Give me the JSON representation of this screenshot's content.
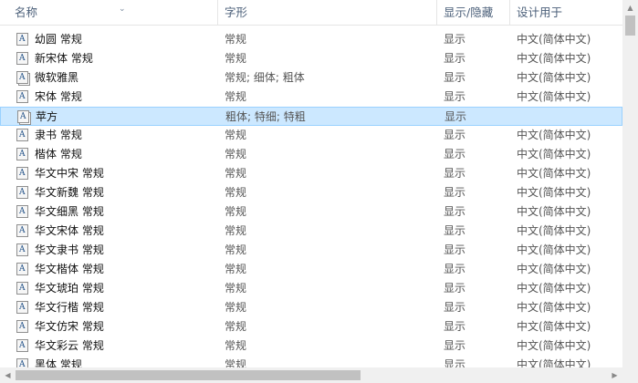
{
  "columns": {
    "name": "名称",
    "style": "字形",
    "show_hide": "显示/隐藏",
    "designed_for": "设计用于"
  },
  "icons": {
    "font_file": "font-file-icon",
    "sort": "chevron-down-icon"
  },
  "colors": {
    "selection_bg": "#cce8ff",
    "selection_border": "#99d1ff",
    "header_text": "#4c607a"
  },
  "rows": [
    {
      "name": "幼圆 常规",
      "style": "常规",
      "show": "显示",
      "design": "中文(简体中文)",
      "family": false,
      "selected": false
    },
    {
      "name": "新宋体 常规",
      "style": "常规",
      "show": "显示",
      "design": "中文(简体中文)",
      "family": false,
      "selected": false
    },
    {
      "name": "微软雅黑",
      "style": "常规; 细体; 粗体",
      "show": "显示",
      "design": "中文(简体中文)",
      "family": true,
      "selected": false
    },
    {
      "name": "宋体 常规",
      "style": "常规",
      "show": "显示",
      "design": "中文(简体中文)",
      "family": false,
      "selected": false
    },
    {
      "name": "苹方",
      "style": "粗体; 特细; 特粗",
      "show": "显示",
      "design": "",
      "family": true,
      "selected": true
    },
    {
      "name": "隶书 常规",
      "style": "常规",
      "show": "显示",
      "design": "中文(简体中文)",
      "family": false,
      "selected": false
    },
    {
      "name": "楷体 常规",
      "style": "常规",
      "show": "显示",
      "design": "中文(简体中文)",
      "family": false,
      "selected": false
    },
    {
      "name": "华文中宋 常规",
      "style": "常规",
      "show": "显示",
      "design": "中文(简体中文)",
      "family": false,
      "selected": false
    },
    {
      "name": "华文新魏 常规",
      "style": "常规",
      "show": "显示",
      "design": "中文(简体中文)",
      "family": false,
      "selected": false
    },
    {
      "name": "华文细黑 常规",
      "style": "常规",
      "show": "显示",
      "design": "中文(简体中文)",
      "family": false,
      "selected": false
    },
    {
      "name": "华文宋体 常规",
      "style": "常规",
      "show": "显示",
      "design": "中文(简体中文)",
      "family": false,
      "selected": false
    },
    {
      "name": "华文隶书 常规",
      "style": "常规",
      "show": "显示",
      "design": "中文(简体中文)",
      "family": false,
      "selected": false
    },
    {
      "name": "华文楷体 常规",
      "style": "常规",
      "show": "显示",
      "design": "中文(简体中文)",
      "family": false,
      "selected": false
    },
    {
      "name": "华文琥珀 常规",
      "style": "常规",
      "show": "显示",
      "design": "中文(简体中文)",
      "family": false,
      "selected": false
    },
    {
      "name": "华文行楷 常规",
      "style": "常规",
      "show": "显示",
      "design": "中文(简体中文)",
      "family": false,
      "selected": false
    },
    {
      "name": "华文仿宋 常规",
      "style": "常规",
      "show": "显示",
      "design": "中文(简体中文)",
      "family": false,
      "selected": false
    },
    {
      "name": "华文彩云 常规",
      "style": "常规",
      "show": "显示",
      "design": "中文(简体中文)",
      "family": false,
      "selected": false
    },
    {
      "name": "黑体 常规",
      "style": "常规",
      "show": "显示",
      "design": "中文(简体中文)",
      "family": false,
      "selected": false
    }
  ]
}
